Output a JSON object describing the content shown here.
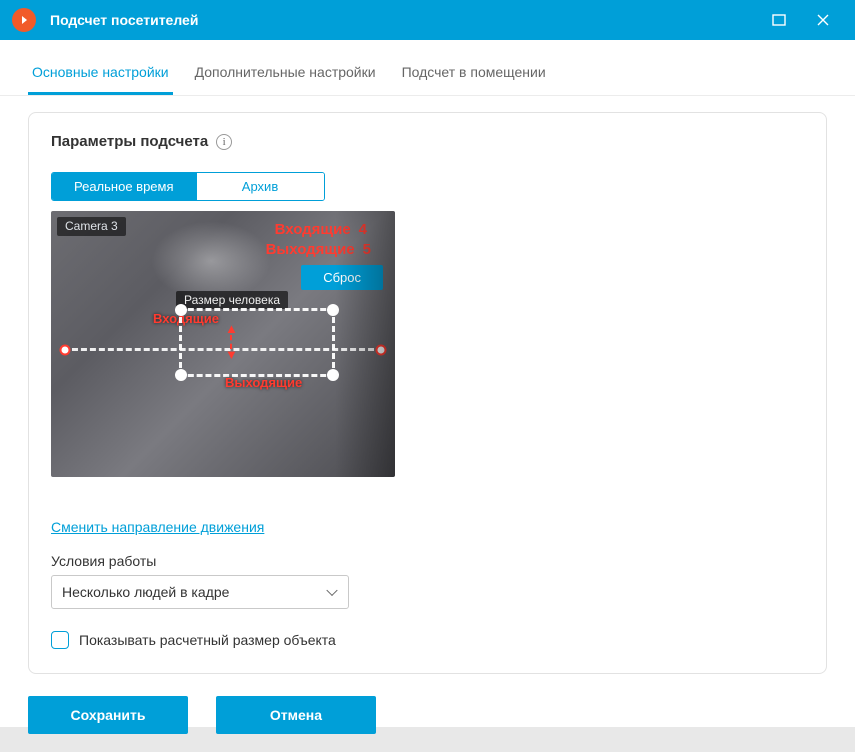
{
  "title": "Подсчет посетителей",
  "tabs": {
    "main": "Основные настройки",
    "extra": "Дополнительные настройки",
    "room": "Подсчет в помещении"
  },
  "card": {
    "title": "Параметры подсчета"
  },
  "mode": {
    "realtime": "Реальное время",
    "archive": "Архив"
  },
  "video": {
    "camera_label": "Camera 3",
    "incoming_label": "Входящие",
    "incoming_count": "4",
    "outgoing_label": "Выходящие",
    "outgoing_count": "5",
    "reset_label": "Сброс",
    "size_label": "Размер человека",
    "dir_in_label": "Входящие",
    "dir_out_label": "Выходящие"
  },
  "swap_link": "Сменить направление движения",
  "work_mode": {
    "label": "Условия работы",
    "value": "Несколько людей в кадре"
  },
  "show_size_checkbox": "Показывать расчетный размер объекта",
  "buttons": {
    "save": "Сохранить",
    "cancel": "Отмена"
  }
}
